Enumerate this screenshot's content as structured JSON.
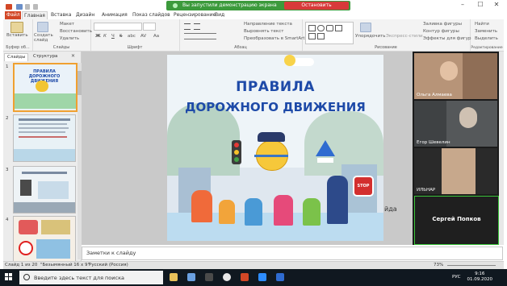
{
  "colors": {
    "accent": "#d24726",
    "zoom_green": "#3c9a3c",
    "zoom_red": "#d83a3a",
    "title_blue": "#1e4aa8"
  },
  "zoom_banner": {
    "message": "Вы запустили демонстрацию экрана",
    "stop_label": "Остановить демонстрацию"
  },
  "window_controls": {
    "minimize": "–",
    "maximize": "☐",
    "close": "✕"
  },
  "tabs": [
    "Файл",
    "Главная",
    "Вставка",
    "Дизайн",
    "Анимация",
    "Показ слайдов",
    "Рецензирование",
    "Вид"
  ],
  "ribbon": {
    "clipboard": {
      "paste": "Вставить",
      "label": "Буфер об..."
    },
    "slides": {
      "create": "Создать слайд",
      "layout": "Макет",
      "reset": "Восстановить",
      "delete": "Удалить",
      "label": "Слайды"
    },
    "font": {
      "label": "Шрифт",
      "bold": "Ж",
      "italic": "К",
      "underline": "Ч",
      "strike": "S",
      "shadow": "abc",
      "spacing": "AV",
      "case": "Aa"
    },
    "paragraph": {
      "direction": "Направление текста",
      "align": "Выровнять текст",
      "smartart": "Преобразовать в SmartArt",
      "label": "Абзац"
    },
    "drawing": {
      "arrange": "Упорядочить",
      "styles": "Экспресс-стили",
      "fill": "Заливка фигуры",
      "outline": "Контур фигуры",
      "effects": "Эффекты для фигур",
      "label": "Рисование"
    },
    "editing": {
      "find": "Найти",
      "replace": "Заменить",
      "select": "Выделить",
      "label": "Редактирование"
    }
  },
  "left_pane": {
    "tab_slides": "Слайды",
    "tab_outline": "Структура",
    "thumb_title": "ПРАВИЛА ДОРОЖНОГО ДВИЖЕНИЯ",
    "slide_numbers": [
      "1",
      "2",
      "3",
      "4"
    ]
  },
  "slide": {
    "title_line1": "ПРАВИЛА",
    "title_line2": "ДОРОЖНОГО ДВИЖЕНИЯ",
    "side_text": "йда",
    "stop_sign": "STOP"
  },
  "notes_placeholder": "Заметки к слайду",
  "video": {
    "participants": [
      "Ольга Алмаева",
      "Егор Шевелин",
      "ИЛЬНАР",
      "Сергей Попков"
    ]
  },
  "status": {
    "slide_info": "Слайд 1 из 20",
    "theme": "\"Безымянный 16 x 9\"",
    "language": "Русский (Россия)",
    "zoom": "73%"
  },
  "taskbar": {
    "search_placeholder": "Введите здесь текст для поиска",
    "lang": "РУС",
    "time": "9:16",
    "date": "01.09.2020"
  }
}
